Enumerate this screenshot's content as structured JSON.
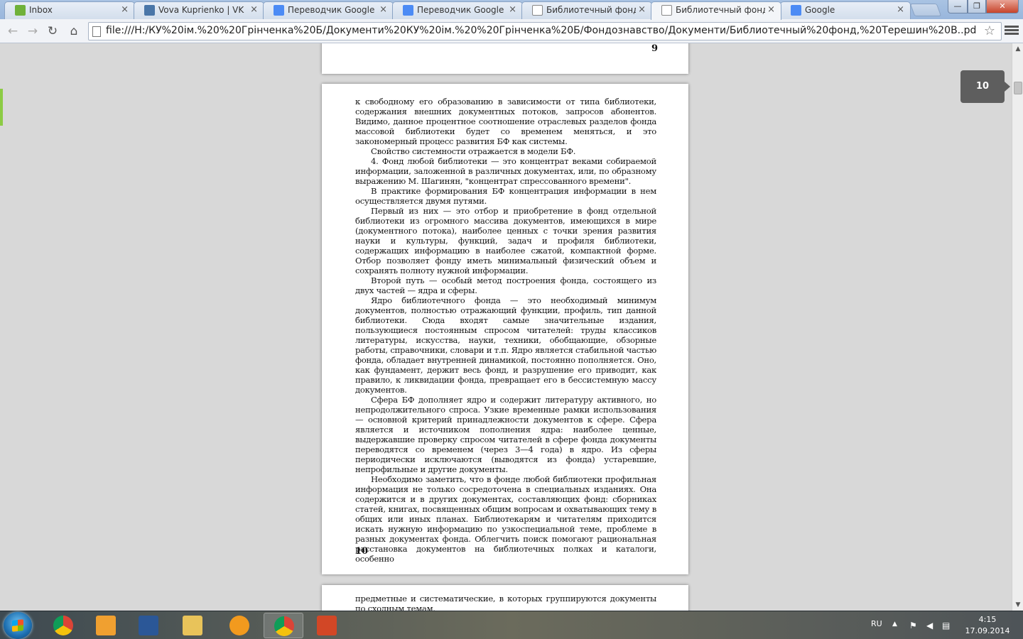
{
  "tabs": [
    {
      "title": "Inbox",
      "close": "×",
      "icon": "inbox-icon",
      "color": "#6fb13a"
    },
    {
      "title": "Vova Kuprienko | VK",
      "close": "×",
      "icon": "vk-icon",
      "color": "#4a76a8"
    },
    {
      "title": "Переводчик Google",
      "close": "×",
      "icon": "google-translate-icon",
      "color": "#4c8bf5"
    },
    {
      "title": "Переводчик Google",
      "close": "×",
      "icon": "google-translate-icon",
      "color": "#4c8bf5"
    },
    {
      "title": "Библиотечный фонд, С",
      "close": "×",
      "icon": "document-icon",
      "color": "#ffffff"
    },
    {
      "title": "Библиотечный фонд, Т",
      "close": "×",
      "icon": "document-icon",
      "color": "#ffffff"
    },
    {
      "title": "Google",
      "close": "×",
      "icon": "google-icon",
      "color": "#4c8bf5"
    }
  ],
  "window": {
    "minimize": "—",
    "maximize": "❐",
    "close": "✕"
  },
  "toolbar": {
    "back": "←",
    "forward": "→",
    "reload": "↻",
    "home": "⌂",
    "star": "☆"
  },
  "address": {
    "url": "file:///H:/КУ%20ім.%20%20Грінченка%20Б/Документи%20КУ%20ім.%20%20Грінченка%20Б/Фондознавство/Документи/Библиотечный%20фонд,%20Терешин%20В..pdf"
  },
  "viewer": {
    "prev_page_number": "9",
    "page_indicator": "10",
    "current_page_number": "10",
    "scroll_up": "▲",
    "scroll_down": "▼",
    "paragraphs": [
      {
        "indent": false,
        "text": "к свободному его образованию в зависимости от типа библиотеки, содержания внешних документных потоков, запросов абонентов. Видимо, данное процентное соотношение отраслевых разделов фонда массовой библиотеки будет со временем меняться, и это закономерный процесс развития БФ как системы."
      },
      {
        "indent": true,
        "text": "Свойство системности отражается в модели БФ."
      },
      {
        "indent": true,
        "text": "4. Фонд любой библиотеки — это концентрат веками собираемой информации, заложенной в различных документах, или, по образному выражению М. Шагинян, \"концентрат спрессованного времени\"."
      },
      {
        "indent": true,
        "text": "В практике формирования БФ концентрация информации в нем осуществляется двумя путями."
      },
      {
        "indent": true,
        "text": "Первый из них — это отбор и приобретение в фонд отдельной библиотеки из огромного массива документов, имеющихся в мире (документного потока), наиболее ценных с точки зрения развития науки и культуры, функций, задач и профиля библиотеки, содержащих информацию в наиболее сжатой, компактной форме. Отбор позволяет фонду иметь минимальный физический объем и сохранять полноту нужной информации."
      },
      {
        "indent": true,
        "text": "Второй путь — особый метод построения фонда, состоящего из двух частей — ядра и сферы."
      },
      {
        "indent": true,
        "text": "Ядро библиотечного фонда — это необходимый минимум документов, полностью отражающий функции, профиль, тип данной библиотеки. Сюда входят самые значительные издания, пользующиеся постоянным спросом читателей: труды классиков литературы, искусства, науки, техники, обобщающие, обзорные работы, справочники, словари и т.п. Ядро является стабильной частью фонда, обладает внутренней динамикой, постоянно пополняется. Оно, как фундамент, держит весь фонд, и разрушение его приводит, как правило, к ликвидации фонда, превращает его в бессистемную массу документов."
      },
      {
        "indent": true,
        "text": "Сфера БФ дополняет ядро и содержит литературу активного, но непродолжительного спроса. Узкие временные рамки использования — основной критерий принадлежности документов к сфере. Сфера является и источником пополнения ядра: наиболее ценные, выдержавшие проверку спросом читателей в сфере фонда документы переводятся со временем (через 3—4 года) в ядро. Из сферы периодически исключаются (выводятся из фонда) устаревшие, непрофильные и другие документы."
      },
      {
        "indent": true,
        "text": "Необходимо заметить, что в фонде любой библиотеки профильная информация не только сосредоточена в специальных изданиях. Она содержится и в других документах, составляющих фонд: сборниках статей, книгах, посвященных общим вопросам и охватывающих тему в общих или иных планах. Библиотекарям и читателям приходится искать нужную информацию по узкоспециальной теме, проблеме в разных документах фонда. Облегчить поиск помогают рациональная расстановка документов на библиотечных полках и каталоги, особенно"
      }
    ],
    "next_page_text": "предметные и систематические, в которых группируются документы по сходным темам."
  },
  "taskbar": {
    "apps": [
      {
        "name": "chrome-icon",
        "color": "#db4437",
        "running": false
      },
      {
        "name": "media-player-icon",
        "color": "#f0a030",
        "running": false
      },
      {
        "name": "word-icon",
        "color": "#2b5797",
        "running": false
      },
      {
        "name": "file-explorer-icon",
        "color": "#e8c35a",
        "running": false
      },
      {
        "name": "fl-studio-icon",
        "color": "#f29a1e",
        "running": false
      },
      {
        "name": "chrome-icon",
        "color": "#db4437",
        "running": true
      },
      {
        "name": "presentation-icon",
        "color": "#d24726",
        "running": false
      }
    ],
    "language": "RU",
    "tray_arrow": "▲",
    "tray_flag": "⚑",
    "tray_volume": "◀",
    "tray_network": "▤",
    "time": "4:15",
    "date": "17.09.2014"
  }
}
